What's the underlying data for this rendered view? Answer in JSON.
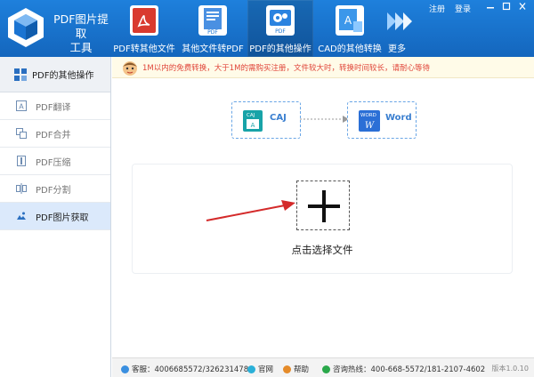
{
  "app": {
    "title_line1": "PDF图片提取",
    "title_line2": "工具"
  },
  "toolbar": {
    "tools": [
      {
        "label": "PDF转其他文件",
        "icon": "pdf-to-other-icon"
      },
      {
        "label": "其他文件转PDF",
        "icon": "other-to-pdf-icon"
      },
      {
        "label": "PDF的其他操作",
        "icon": "pdf-gear-icon",
        "active": true
      },
      {
        "label": "CAD的其他转换",
        "icon": "cad-convert-icon"
      }
    ],
    "more_label": "更多",
    "register": "注册",
    "login": "登录"
  },
  "sidebar": {
    "header": "PDF的其他操作",
    "items": [
      {
        "label": "PDF翻译",
        "icon": "translate-icon"
      },
      {
        "label": "PDF合并",
        "icon": "merge-icon"
      },
      {
        "label": "PDF压缩",
        "icon": "compress-icon"
      },
      {
        "label": "PDF分割",
        "icon": "split-icon"
      },
      {
        "label": "PDF图片获取",
        "icon": "image-extract-icon",
        "active": true
      }
    ]
  },
  "notice": {
    "text": "1M以内的免费转换，大于1M的需购买注册，文件较大时，转换时间较长，请耐心等待"
  },
  "conversion": {
    "from_badge": "CAJ",
    "from_label": "CAJ",
    "to_badge": "WORD",
    "to_letter": "W",
    "to_label": "Word"
  },
  "dropzone": {
    "label": "点击选择文件"
  },
  "status": {
    "support": "客服：4006685572/326231478",
    "website": "官网",
    "help": "帮助",
    "hotline": "咨询热线：400-668-5572/181-2107-4602",
    "version": "版本1.0.10"
  },
  "colors": {
    "topbar": "#1a74d2",
    "accent": "#3a7fd0",
    "notice_text": "#e0463a",
    "arrow": "#d42a2a"
  }
}
